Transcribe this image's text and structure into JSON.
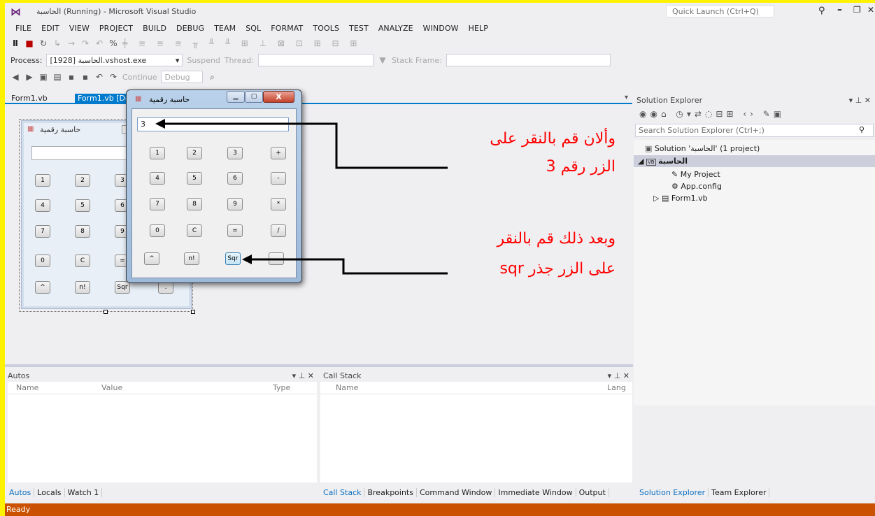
{
  "window": {
    "title": "الحاسبة (Running) - Microsoft Visual Studio",
    "quick_launch": "Quick Launch (Ctrl+Q)"
  },
  "menu": [
    "FILE",
    "EDIT",
    "VIEW",
    "PROJECT",
    "BUILD",
    "DEBUG",
    "TEAM",
    "SQL",
    "FORMAT",
    "TOOLS",
    "TEST",
    "ANALYZE",
    "WINDOW",
    "HELP"
  ],
  "debug_toolbar": {
    "process_label": "Process:",
    "process_value": "[1928] الحاسبة.vshost.exe",
    "suspend": "Suspend",
    "thread": "Thread:",
    "stack_frame": "Stack Frame:"
  },
  "std_toolbar": {
    "continue": "Continue",
    "config": "Debug"
  },
  "doc_tabs": [
    "Form1.vb",
    "Form1.vb [Des"
  ],
  "designer_form": {
    "title": "حاسبة رقمية",
    "buttons": [
      "1",
      "2",
      "3",
      "4",
      "5",
      "6",
      "7",
      "8",
      "9",
      "0",
      "C",
      "=",
      "^",
      "n!",
      "Sqr",
      "."
    ]
  },
  "running_form": {
    "title": "حاسبة رقمية",
    "display": "3",
    "buttons": [
      [
        "1",
        "2",
        "3",
        "+"
      ],
      [
        "4",
        "5",
        "6",
        "-"
      ],
      [
        "7",
        "8",
        "9",
        "*"
      ],
      [
        "0",
        "C",
        "=",
        "/"
      ],
      [
        "^",
        "n!",
        "Sqr",
        "."
      ]
    ]
  },
  "annotations": {
    "line1a": "وألان قم بالنقر على",
    "line1b": "الزر رقم 3",
    "line2a": "وبعد ذلك قم بالنقر",
    "line2b": "على الزر جذر sqr"
  },
  "solution_explorer": {
    "title": "Solution Explorer",
    "search": "Search Solution Explorer (Ctrl+;)",
    "solution": "Solution 'الحاسبة' (1 project)",
    "project": "الحاسبة",
    "items": [
      "My Project",
      "App.config",
      "Form1.vb"
    ],
    "tabs": [
      "Solution Explorer",
      "Team Explorer"
    ]
  },
  "autos": {
    "title": "Autos",
    "cols": [
      "Name",
      "Value",
      "Type"
    ],
    "tabs": [
      "Autos",
      "Locals",
      "Watch 1"
    ]
  },
  "callstack": {
    "title": "Call Stack",
    "cols": [
      "Name",
      "Lang"
    ],
    "tabs": [
      "Call Stack",
      "Breakpoints",
      "Command Window",
      "Immediate Window",
      "Output"
    ]
  },
  "status": "Ready",
  "colors": {
    "accent": "#007ACC",
    "status": "#CA5100",
    "annotation": "#FF0000",
    "frame": "#FFF200"
  }
}
